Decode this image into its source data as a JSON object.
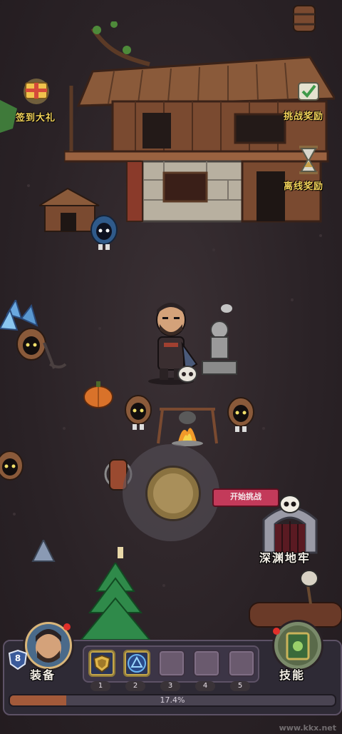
{
  "top_left_reward": {
    "label": "签到大礼",
    "icon": "gift-scroll-icon"
  },
  "right_rewards": [
    {
      "label": "挑战奖励",
      "icon": "checkmark-scroll-icon"
    },
    {
      "label": "离线奖励",
      "icon": "hourglass-icon"
    }
  ],
  "dungeon": {
    "button_label": "开始挑战",
    "name": "深渊地牢",
    "icon": "skull-gate-icon"
  },
  "hud": {
    "level": "8",
    "equip_label": "装备",
    "skills_label": "技能",
    "slots": [
      {
        "num": "1",
        "icon": "shield-icon",
        "filled": true
      },
      {
        "num": "2",
        "icon": "magic-circle-icon",
        "filled": true
      },
      {
        "num": "3",
        "icon": "",
        "filled": false
      },
      {
        "num": "4",
        "icon": "",
        "filled": false
      },
      {
        "num": "5",
        "icon": "",
        "filled": false
      }
    ],
    "progress_text": "17.4%",
    "progress_value": 0.174
  },
  "watermark": "www.kkx.net",
  "colors": {
    "label_gold": "#f3d35a",
    "hud_bg": "#2e2a35",
    "progress_fill": "#a35a3a",
    "ground": "#2b2326"
  }
}
